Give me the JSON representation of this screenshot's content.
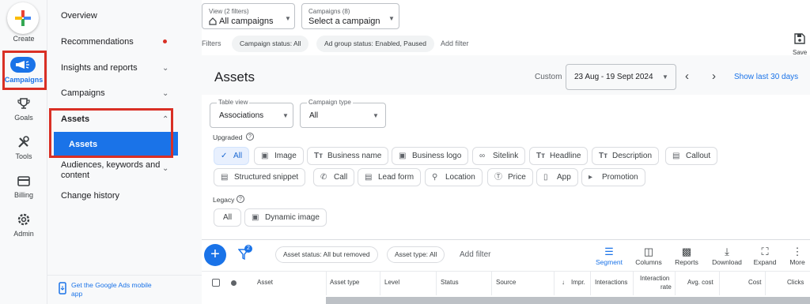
{
  "rail": {
    "create_label": "Create",
    "items": [
      {
        "label": "Campaigns",
        "icon": "megaphone-icon"
      },
      {
        "label": "Goals",
        "icon": "trophy-icon"
      },
      {
        "label": "Tools",
        "icon": "tools-icon"
      },
      {
        "label": "Billing",
        "icon": "credit-card-icon"
      },
      {
        "label": "Admin",
        "icon": "gear-icon"
      }
    ]
  },
  "nav": {
    "items": [
      "Overview",
      "Recommendations",
      "Insights and reports",
      "Campaigns",
      "Assets",
      "Assets",
      "Audiences, keywords and",
      "content",
      "Change history"
    ],
    "footer_line1": "Get the Google Ads mobile",
    "footer_line2": "app"
  },
  "header": {
    "view_label": "View (2 filters)",
    "view_value": "All campaigns",
    "campaigns_label": "Campaigns (8)",
    "campaigns_value": "Select a campaign",
    "filters_label": "Filters",
    "filter_chips": [
      "Campaign status: All",
      "Ad group status: Enabled, Paused"
    ],
    "add_filter": "Add filter",
    "save_label": "Save"
  },
  "page": {
    "title": "Assets",
    "date_mode": "Custom",
    "date_range": "23 Aug - 19 Sept 2024",
    "show_last": "Show last 30 days"
  },
  "controls": {
    "table_view_label": "Table view",
    "table_view_value": "Associations",
    "campaign_type_label": "Campaign type",
    "campaign_type_value": "All",
    "upgraded_label": "Upgraded",
    "legacy_label": "Legacy",
    "upgraded_row1": [
      "All",
      "Image",
      "Business name",
      "Business logo",
      "Sitelink",
      "Headline",
      "Description",
      "Callout"
    ],
    "upgraded_row2": [
      "Structured snippet",
      "Call",
      "Lead form",
      "Location",
      "Price",
      "App",
      "Promotion"
    ],
    "legacy_chips": [
      "All",
      "Dynamic image"
    ]
  },
  "table_toolbar": {
    "filter_badge": "2",
    "filter_chips": [
      "Asset status: All but removed",
      "Asset type: All"
    ],
    "add_filter": "Add filter",
    "tools": [
      "Segment",
      "Columns",
      "Reports",
      "Download",
      "Expand",
      "More"
    ]
  },
  "table": {
    "headers": [
      "Asset",
      "Asset type",
      "Level",
      "Status",
      "Source",
      "Impr.",
      "Interactions",
      "Interaction",
      "rate",
      "Avg. cost",
      "Cost",
      "Clicks"
    ]
  },
  "colors": {
    "accent": "#1a73e8",
    "highlight": "#d93025"
  }
}
